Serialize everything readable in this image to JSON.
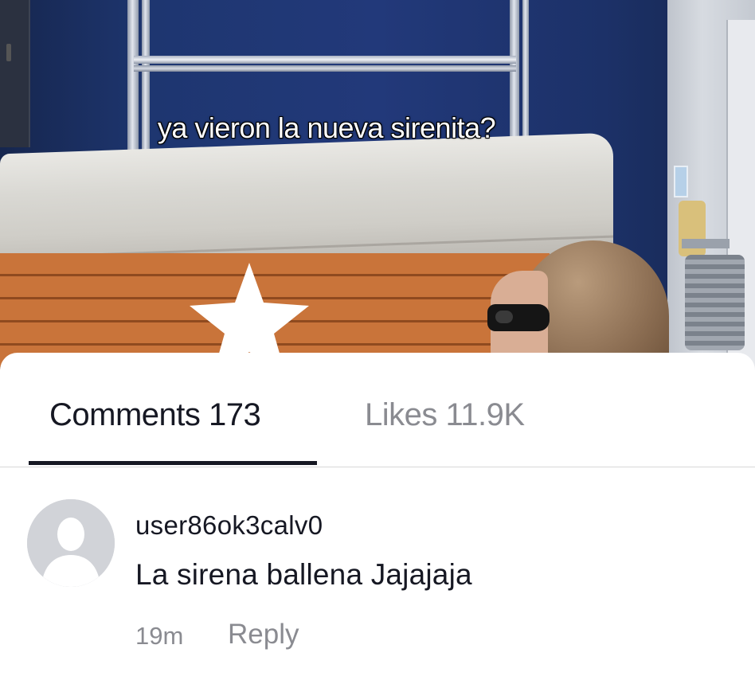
{
  "video": {
    "caption": "ya vieron la nueva sirenita?"
  },
  "tabs": [
    {
      "label": "Comments 173",
      "active": true
    },
    {
      "label": "Likes 11.9K",
      "active": false
    }
  ],
  "comments": [
    {
      "username": "user86ok3calv0",
      "text": "La sirena ballena Jajajaja",
      "time": "19m",
      "reply_label": "Reply",
      "avatar_icon": "default-user-avatar-icon"
    }
  ],
  "colors": {
    "text_primary": "#161823",
    "text_secondary": "#8a8b91",
    "divider": "#d7d7d7",
    "avatar_bg": "#d1d3d8"
  }
}
